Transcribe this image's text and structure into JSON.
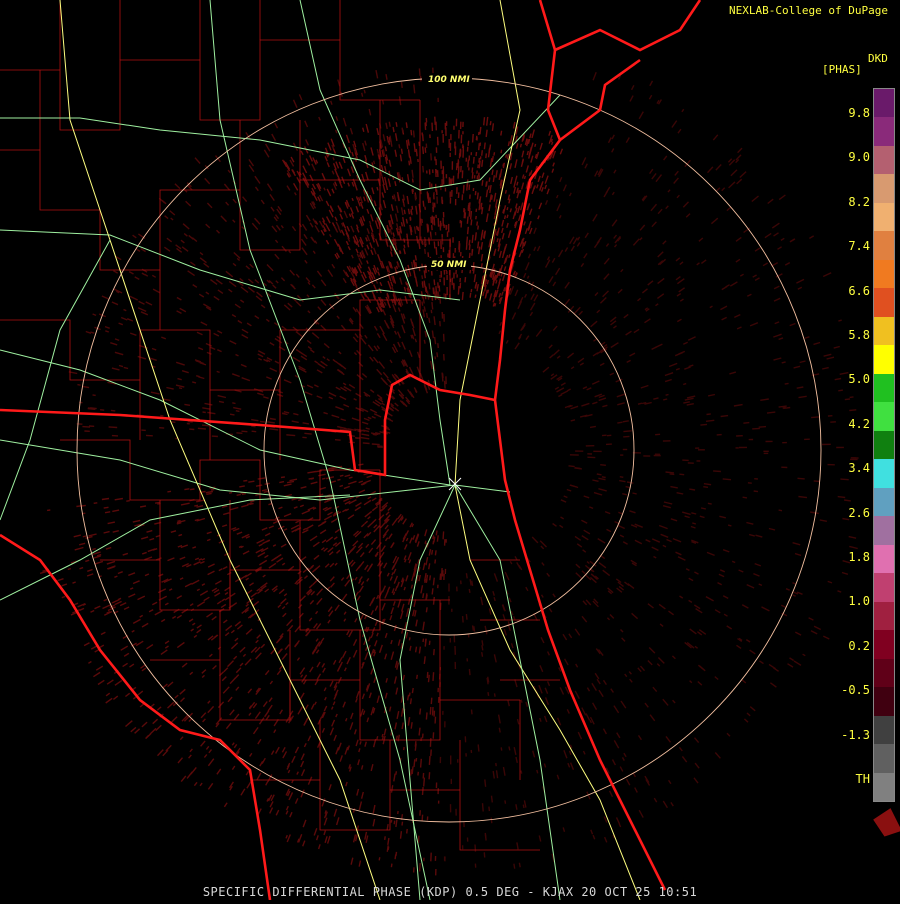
{
  "header": {
    "credit": "NEXLAB-College of DuPage"
  },
  "legend": {
    "units_top": "DKD",
    "units_bottom": "[PHAS]",
    "labels": [
      "9.8",
      "9.0",
      "8.2",
      "7.4",
      "6.6",
      "5.8",
      "5.0",
      "4.2",
      "3.4",
      "2.6",
      "1.8",
      "1.0",
      "0.2",
      "-0.5",
      "-1.3",
      "TH"
    ],
    "colors": [
      "#6a1a6a",
      "#8a2a7a",
      "#b46070",
      "#d89a70",
      "#f0b070",
      "#e08040",
      "#f07a20",
      "#e05020",
      "#f0c020",
      "#ffff00",
      "#20c020",
      "#40e040",
      "#108010",
      "#40e0e0",
      "#60a0c0",
      "#a070a0",
      "#e070b0",
      "#c04070",
      "#a02040",
      "#800020",
      "#600018",
      "#400010",
      "#404040",
      "#606060",
      "#808080"
    ]
  },
  "map": {
    "ring_labels": [
      "100 NMI",
      "50 NMI"
    ]
  },
  "footer": {
    "caption": "SPECIFIC DIFFERENTIAL PHASE (KDP) 0.5 DEG - KJAX 20 OCT 25 10:51"
  }
}
